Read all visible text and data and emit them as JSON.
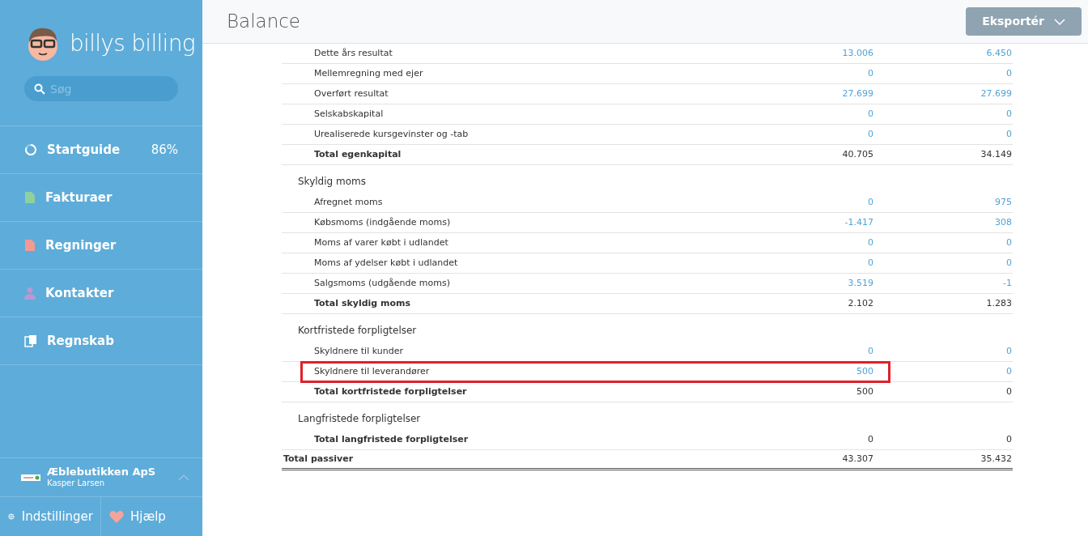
{
  "sidebar": {
    "logo": "billys billing",
    "search": {
      "placeholder": "Søg"
    },
    "items": [
      {
        "label": "Startguide",
        "badge": "86%",
        "kind": "progress"
      },
      {
        "label": "Fakturaer",
        "kind": "invoice"
      },
      {
        "label": "Regninger",
        "kind": "bill"
      },
      {
        "label": "Kontakter",
        "kind": "contact"
      },
      {
        "label": "Regnskab",
        "kind": "ledger"
      }
    ],
    "company": {
      "name": "Æblebutikken ApS",
      "user": "Kasper Larsen"
    },
    "footer": [
      {
        "label": "Indstillinger",
        "kind": "settings"
      },
      {
        "label": "Hjælp",
        "kind": "help"
      }
    ]
  },
  "header": {
    "title": "Balance",
    "export_button": "Eksportér"
  },
  "rows": [
    {
      "kind": "item",
      "label": "Dette års resultat",
      "v1": "13.006",
      "v2": "6.450",
      "highlighted": false
    },
    {
      "kind": "item",
      "label": "Mellemregning med ejer",
      "v1": "0",
      "v2": "0",
      "highlighted": false
    },
    {
      "kind": "item",
      "label": "Overført resultat",
      "v1": "27.699",
      "v2": "27.699",
      "highlighted": false
    },
    {
      "kind": "item",
      "label": "Selskabskapital",
      "v1": "0",
      "v2": "0",
      "highlighted": false
    },
    {
      "kind": "item",
      "label": "Urealiserede kursgevinster og -tab",
      "v1": "0",
      "v2": "0",
      "highlighted": false
    },
    {
      "kind": "total",
      "label": "Total egenkapital",
      "v1": "40.705",
      "v2": "34.149",
      "highlighted": false
    },
    {
      "kind": "heading",
      "label": "Skyldig moms"
    },
    {
      "kind": "item",
      "label": "Afregnet moms",
      "v1": "0",
      "v2": "975",
      "highlighted": false
    },
    {
      "kind": "item",
      "label": "Købsmoms (indgående moms)",
      "v1": "-1.417",
      "v2": "308",
      "highlighted": false
    },
    {
      "kind": "item",
      "label": "Moms af varer købt i udlandet",
      "v1": "0",
      "v2": "0",
      "highlighted": false
    },
    {
      "kind": "item",
      "label": "Moms af ydelser købt i udlandet",
      "v1": "0",
      "v2": "0",
      "highlighted": false
    },
    {
      "kind": "item",
      "label": "Salgsmoms (udgående moms)",
      "v1": "3.519",
      "v2": "-1",
      "highlighted": false
    },
    {
      "kind": "total",
      "label": "Total skyldig moms",
      "v1": "2.102",
      "v2": "1.283",
      "highlighted": false
    },
    {
      "kind": "heading",
      "label": "Kortfristede forpligtelser"
    },
    {
      "kind": "item",
      "label": "Skyldnere til kunder",
      "v1": "0",
      "v2": "0",
      "highlighted": false
    },
    {
      "kind": "item",
      "label": "Skyldnere til leverandører",
      "v1": "500",
      "v2": "0",
      "highlighted": true
    },
    {
      "kind": "total",
      "label": "Total kortfristede forpligtelser",
      "v1": "500",
      "v2": "0",
      "highlighted": false
    },
    {
      "kind": "heading",
      "label": "Langfristede forpligtelser"
    },
    {
      "kind": "total",
      "label": "Total langfristede forpligtelser",
      "v1": "0",
      "v2": "0",
      "highlighted": false
    },
    {
      "kind": "grand_total",
      "label": "Total passiver",
      "v1": "43.307",
      "v2": "35.432",
      "highlighted": false
    }
  ]
}
